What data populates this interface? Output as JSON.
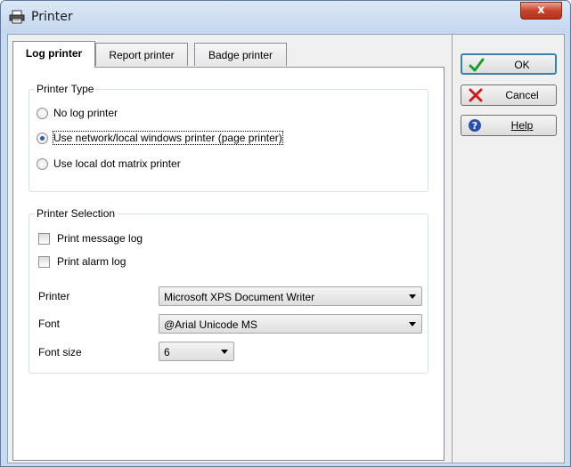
{
  "window": {
    "title": "Printer",
    "close_glyph": "x"
  },
  "tabs": [
    {
      "label": "Log printer",
      "active": true
    },
    {
      "label": "Report printer",
      "active": false
    },
    {
      "label": "Badge printer",
      "active": false
    }
  ],
  "printer_type": {
    "legend": "Printer Type",
    "options": [
      {
        "label": "No log printer",
        "selected": false
      },
      {
        "label": "Use network/local windows printer (page printer)",
        "selected": true
      },
      {
        "label": "Use local dot matrix printer",
        "selected": false
      }
    ]
  },
  "printer_selection": {
    "legend": "Printer Selection",
    "checkboxes": [
      {
        "label": "Print message log",
        "checked": false
      },
      {
        "label": "Print alarm log",
        "checked": false
      }
    ],
    "printer": {
      "label": "Printer",
      "value": "Microsoft XPS Document Writer"
    },
    "font": {
      "label": "Font",
      "value": "@Arial Unicode MS"
    },
    "font_size": {
      "label": "Font size",
      "value": "6"
    }
  },
  "buttons": {
    "ok": {
      "label": "OK",
      "icon": "checkmark-icon",
      "color": "#1f9a2f"
    },
    "cancel": {
      "label": "Cancel",
      "icon": "x-mark-icon",
      "color": "#d11a1a"
    },
    "help": {
      "label": "Help",
      "icon": "question-icon",
      "color": "#2a4fb0"
    }
  }
}
